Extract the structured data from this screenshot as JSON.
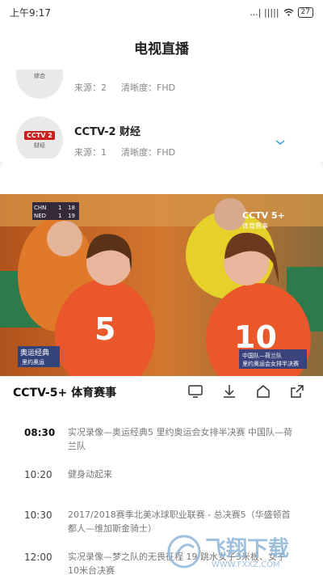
{
  "status_bar": {
    "time": "上午9:17",
    "network": "...| |||||",
    "battery": "27"
  },
  "header": {
    "title": "电视直播"
  },
  "channels": [
    {
      "logo_badge": "",
      "logo_sub": "综合",
      "name": "",
      "source": "来源：2",
      "quality": "清晰度：FHD"
    },
    {
      "logo_badge": "CCTV 2",
      "logo_sub": "财经",
      "name": "CCTV-2 财经",
      "source": "来源：1",
      "quality": "清晰度：FHD"
    }
  ],
  "player": {
    "score_rows": [
      {
        "team": "CHN",
        "sets": "1",
        "points": "18"
      },
      {
        "team": "NED",
        "sets": "1",
        "points": "19"
      }
    ],
    "channel_bug": "CCTV 5+",
    "channel_bug_sub": "体育赛事",
    "program_tag_1": "奥运经典",
    "program_tag_2": "里约奥运",
    "caption_line1": "中国队—荷兰队",
    "caption_line2": "里约奥运会女排半决赛",
    "jersey_left": "5",
    "jersey_right": "10"
  },
  "now_playing": {
    "title": "CCTV-5+ 体育赛事"
  },
  "epg": [
    {
      "time": "08:30",
      "title": "实况录像—奥运经典5  里约奥运会女排半决赛 中国队—荷兰队",
      "current": true
    },
    {
      "time": "10:20",
      "title": "健身动起来",
      "current": false
    },
    {
      "time": "10:30",
      "title": "2017/2018赛季北美冰球职业联赛 - 总决赛5（华盛顿首都人—维加斯金骑士）",
      "current": false
    },
    {
      "time": "12:00",
      "title": "实况录像—梦之队的无畏征程 19  跳水女子3米板、女子10米台决赛",
      "current": false
    }
  ],
  "watermark": {
    "brand": "飞翔下载",
    "url": "WWW.FXXZ.COM"
  }
}
